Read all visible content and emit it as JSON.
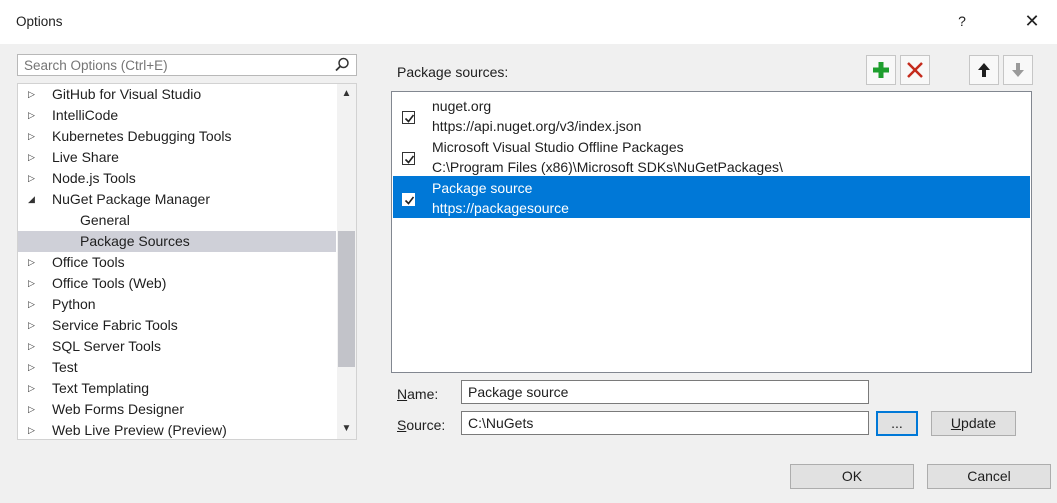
{
  "window": {
    "title": "Options",
    "help": "?",
    "close": "✕"
  },
  "search": {
    "placeholder": "Search Options (Ctrl+E)"
  },
  "tree": {
    "items": [
      {
        "label": "GitHub for Visual Studio",
        "arrow": "▷"
      },
      {
        "label": "IntelliCode",
        "arrow": "▷"
      },
      {
        "label": "Kubernetes Debugging Tools",
        "arrow": "▷"
      },
      {
        "label": "Live Share",
        "arrow": "▷"
      },
      {
        "label": "Node.js Tools",
        "arrow": "▷"
      },
      {
        "label": "NuGet Package Manager",
        "arrow": "◢"
      },
      {
        "label": "General"
      },
      {
        "label": "Package Sources"
      },
      {
        "label": "Office Tools",
        "arrow": "▷"
      },
      {
        "label": "Office Tools (Web)",
        "arrow": "▷"
      },
      {
        "label": "Python",
        "arrow": "▷"
      },
      {
        "label": "Service Fabric Tools",
        "arrow": "▷"
      },
      {
        "label": "SQL Server Tools",
        "arrow": "▷"
      },
      {
        "label": "Test",
        "arrow": "▷"
      },
      {
        "label": "Text Templating",
        "arrow": "▷"
      },
      {
        "label": "Web Forms Designer",
        "arrow": "▷"
      },
      {
        "label": "Web Live Preview (Preview)",
        "arrow": "▷"
      }
    ],
    "selected": "Package Sources",
    "scroll_up": "▲",
    "scroll_down": "▼"
  },
  "panel": {
    "label": "Package sources:",
    "sources": [
      {
        "name": "nuget.org",
        "url": "https://api.nuget.org/v3/index.json",
        "checked": true
      },
      {
        "name": "Microsoft Visual Studio Offline Packages",
        "url": "C:\\Program Files (x86)\\Microsoft SDKs\\NuGetPackages\\",
        "checked": true
      },
      {
        "name": "Package source",
        "url": "https://packagesource",
        "checked": true,
        "selected": true
      }
    ]
  },
  "form": {
    "name_label_underlined": "N",
    "name_label_rest": "ame:",
    "name_value": "Package source",
    "source_label_underlined": "S",
    "source_label_rest": "ource:",
    "source_value": "C:\\NuGets",
    "browse": "...",
    "update_underlined": "U",
    "update_rest": "pdate"
  },
  "buttons": {
    "ok": "OK",
    "cancel": "Cancel"
  },
  "colors": {
    "accent": "#0078d7",
    "add": "#1e9e2e",
    "remove": "#c42b1c"
  }
}
